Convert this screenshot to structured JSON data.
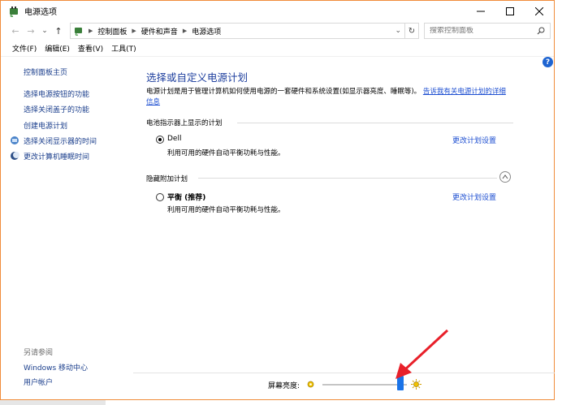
{
  "window": {
    "title": "电源选项",
    "controls": {
      "minimize": "—",
      "maximize": "☐",
      "close": "✕"
    }
  },
  "address": {
    "back": "←",
    "forward": "→",
    "recent": "⌄",
    "up": "↑",
    "crumbs": [
      "控制面板",
      "硬件和声音",
      "电源选项"
    ],
    "dropdown": "⌄",
    "refresh": "↻"
  },
  "search": {
    "placeholder": "搜索控制面板"
  },
  "menu": {
    "items": [
      "文件(F)",
      "编辑(E)",
      "查看(V)",
      "工具(T)"
    ]
  },
  "sidebar": {
    "home": "控制面板主页",
    "links": [
      "选择电源按钮的功能",
      "选择关闭盖子的功能",
      "创建电源计划",
      "选择关闭显示器的时间",
      "更改计算机睡眠时间"
    ],
    "see_also": "另请参阅",
    "see_also_links": [
      "Windows 移动中心",
      "用户帐户"
    ]
  },
  "main": {
    "title": "选择或自定义电源计划",
    "desc_text": "电源计划是用于管理计算机如何使用电源的一套硬件和系统设置(如显示器亮度、睡眠等)。",
    "desc_link": "告诉我有关电源计划的详细信息",
    "battery_section": "电池指示器上显示的计划",
    "hidden_section": "隐藏附加计划",
    "plans": [
      {
        "name": "Dell",
        "desc": "利用可用的硬件自动平衡功耗与性能。",
        "change": "更改计划设置",
        "selected": true
      },
      {
        "name": "平衡 (推荐)",
        "desc": "利用可用的硬件自动平衡功耗与性能。",
        "change": "更改计划设置",
        "selected": false
      }
    ]
  },
  "brightness": {
    "label": "屏幕亮度:",
    "level": 0.92
  },
  "help": "?",
  "colors": {
    "link": "#1e4fd1",
    "title": "#1e3f9e",
    "accent": "#1a73e8",
    "window_border": "#f08c3a",
    "arrow": "#e8202a"
  }
}
